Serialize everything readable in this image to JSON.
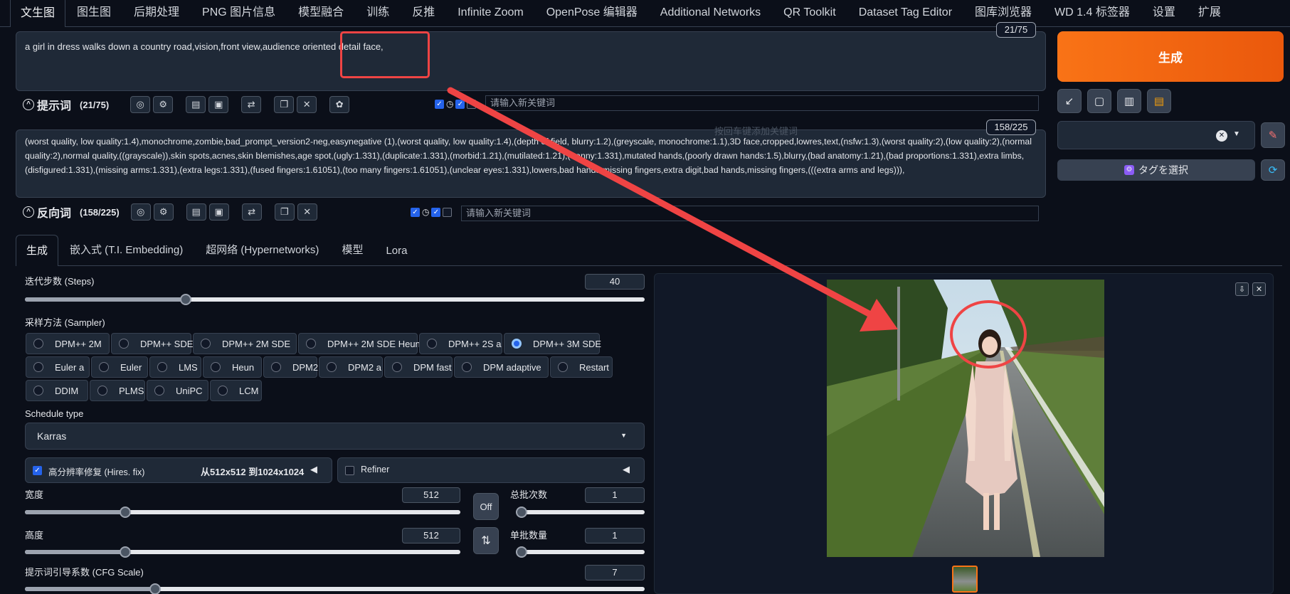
{
  "top_tabs": [
    "文生图",
    "图生图",
    "后期处理",
    "PNG 图片信息",
    "模型融合",
    "训练",
    "反推",
    "Infinite Zoom",
    "OpenPose 编辑器",
    "Additional Networks",
    "QR Toolkit",
    "Dataset Tag Editor",
    "图库浏览器",
    "WD 1.4 标签器",
    "设置",
    "扩展"
  ],
  "positive": {
    "text": "a girl in dress walks down a country road,vision,front view,audience oriented detail face,",
    "counter": "21/75",
    "label": "提示词",
    "count": "(21/75)",
    "keyword_placeholder": "请输入新关键词"
  },
  "negative": {
    "text": "(worst quality, low quality:1.4),monochrome,zombie,bad_prompt_version2-neg,easynegative (1),(worst quality, low quality:1.4),(depth of field, blurry:1.2),(greyscale, monochrome:1.1),3D face,cropped,lowres,text,(nsfw:1.3),(worst quality:2),(low quality:2),(normal quality:2),normal quality,((grayscale)),skin spots,acnes,skin blemishes,age spot,(ugly:1.331),(duplicate:1.331),(morbid:1.21),(mutilated:1.21),(tranny:1.331),mutated hands,(poorly drawn hands:1.5),blurry,(bad anatomy:1.21),(bad proportions:1.331),extra limbs,(disfigured:1.331),(missing arms:1.331),(extra legs:1.331),(fused fingers:1.61051),(too many fingers:1.61051),(unclear eyes:1.331),lowers,bad hands,missing fingers,extra digit,bad hands,missing fingers,(((extra arms and legs))),",
    "counter": "158/225",
    "label": "反向词",
    "count": "(158/225)",
    "keyword_placeholder": "请输入新关键词",
    "hint": "按回车键添加关键词"
  },
  "generate_label": "生成",
  "tag_select_label": "タグを選択",
  "sub_tabs": [
    "生成",
    "嵌入式 (T.I. Embedding)",
    "超网络 (Hypernetworks)",
    "模型",
    "Lora"
  ],
  "steps": {
    "label": "迭代步数 (Steps)",
    "value": "40",
    "fraction": 0.26
  },
  "sampler": {
    "label": "采样方法 (Sampler)",
    "options": [
      "DPM++ 2M",
      "DPM++ SDE",
      "DPM++ 2M SDE",
      "DPM++ 2M SDE Heun",
      "DPM++ 2S a",
      "DPM++ 3M SDE",
      "Euler a",
      "Euler",
      "LMS",
      "Heun",
      "DPM2",
      "DPM2 a",
      "DPM fast",
      "DPM adaptive",
      "Restart",
      "DDIM",
      "PLMS",
      "UniPC",
      "LCM"
    ],
    "selected": "DPM++ 3M SDE"
  },
  "schedule": {
    "label": "Schedule type",
    "value": "Karras"
  },
  "hires": {
    "label": "高分辨率修复 (Hires. fix)",
    "info": "从512x512 到1024x1024",
    "checked": true
  },
  "refiner": {
    "label": "Refiner",
    "checked": false
  },
  "width": {
    "label": "宽度",
    "value": "512",
    "fraction": 0.23
  },
  "height": {
    "label": "高度",
    "value": "512",
    "fraction": 0.23
  },
  "off_label": "Off",
  "batch_count": {
    "label": "总批次数",
    "value": "1",
    "fraction": 0.0
  },
  "batch_size": {
    "label": "单批数量",
    "value": "1",
    "fraction": 0.0
  },
  "cfg": {
    "label": "提示词引导系数 (CFG Scale)",
    "value": "7",
    "fraction": 0.21
  },
  "icons": {
    "collapse": "collapse-icon",
    "globe": "globe-icon",
    "gear": "gear-icon",
    "doc": "doc-icon",
    "bookmark": "bookmark-icon",
    "translate": "translate-icon",
    "copy": "copy-icon",
    "trash": "trash-icon",
    "openai": "openai-icon"
  },
  "colors": {
    "accent": "#ea580c",
    "annotation": "#ef4444",
    "checkbox": "#2563eb"
  }
}
